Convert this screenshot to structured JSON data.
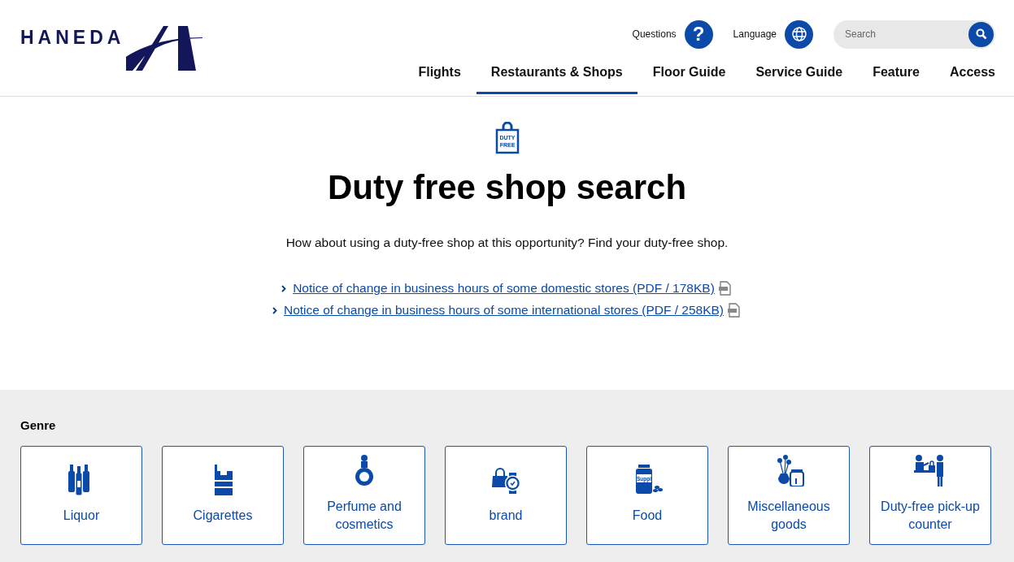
{
  "header": {
    "logo": "HANEDA",
    "utilities": [
      {
        "label": "Questions",
        "kind": "question",
        "glyph": "?"
      },
      {
        "label": "Language",
        "kind": "globe"
      }
    ],
    "search": {
      "placeholder": "Search"
    }
  },
  "nav": [
    {
      "label": "Flights",
      "selected": false
    },
    {
      "label": "Restaurants & Shops",
      "selected": true
    },
    {
      "label": "Floor Guide",
      "selected": false
    },
    {
      "label": "Service Guide",
      "selected": false
    },
    {
      "label": "Feature",
      "selected": false
    },
    {
      "label": "Access",
      "selected": false
    }
  ],
  "hero": {
    "icon_text": [
      "DUTY",
      "FREE"
    ],
    "title": "Duty free shop search",
    "lead": "How about using a duty-free shop at this opportunity? Find your duty-free shop.",
    "links": [
      {
        "text": "Notice of change in business hours of some domestic stores (PDF / 178KB)"
      },
      {
        "text": "Notice of change in business hours of some international stores (PDF / 258KB)"
      }
    ]
  },
  "genre": {
    "heading": "Genre",
    "items": [
      {
        "label": "Liquor",
        "kind": "liquor"
      },
      {
        "label": "Cigarettes",
        "kind": "cigarettes"
      },
      {
        "label": "Perfume and cosmetics",
        "kind": "perfume"
      },
      {
        "label": "brand",
        "kind": "brand"
      },
      {
        "label": "Food",
        "kind": "food",
        "icon_text": "Suppl"
      },
      {
        "label": "Miscellaneous goods",
        "kind": "misc"
      },
      {
        "label": "Duty-free pick-up counter",
        "kind": "pickup"
      }
    ]
  }
}
